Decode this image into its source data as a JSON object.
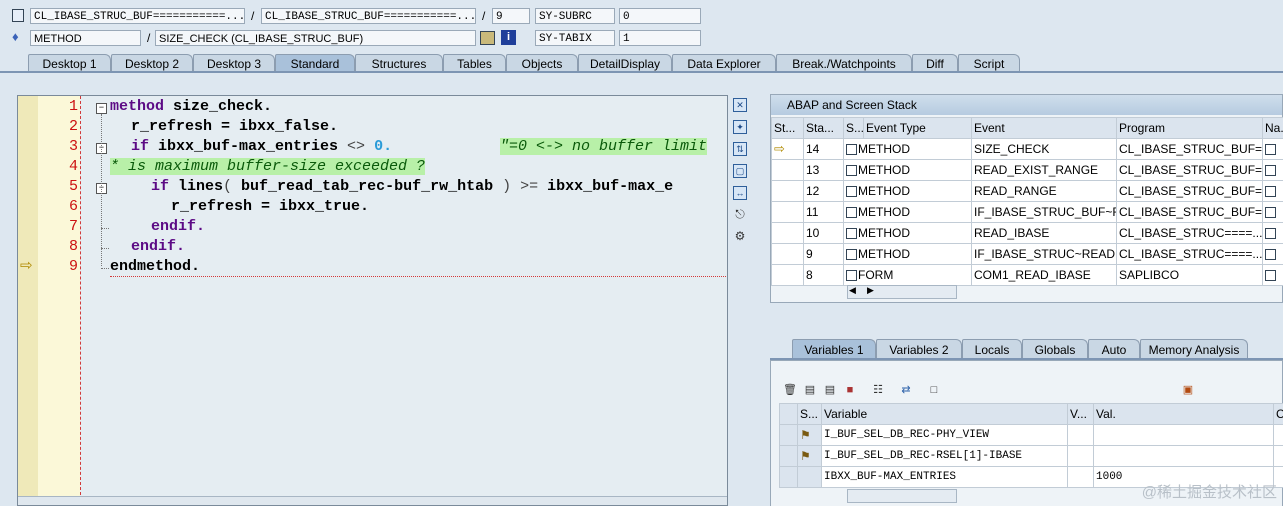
{
  "header": {
    "row1": {
      "program": "CL_IBASE_STRUC_BUF===========...",
      "include": "CL_IBASE_STRUC_BUF===========...",
      "line": "9",
      "sysvar_name": "SY-SUBRC",
      "sysvar_value": "0"
    },
    "row2": {
      "event_type": "METHOD",
      "event": "SIZE_CHECK (CL_IBASE_STRUC_BUF)",
      "sysvar_name": "SY-TABIX",
      "sysvar_value": "1"
    },
    "slash": "/"
  },
  "tabs": [
    "Desktop 1",
    "Desktop 2",
    "Desktop 3",
    "Standard",
    "Structures",
    "Tables",
    "Objects",
    "DetailDisplay",
    "Data Explorer",
    "Break./Watchpoints",
    "Diff",
    "Script"
  ],
  "active_tab": "Standard",
  "editor": {
    "lines": [
      {
        "no": "1"
      },
      {
        "no": "2"
      },
      {
        "no": "3"
      },
      {
        "no": "4"
      },
      {
        "no": "5"
      },
      {
        "no": "6"
      },
      {
        "no": "7"
      },
      {
        "no": "8"
      },
      {
        "no": "9"
      }
    ],
    "code": {
      "l1_kw": "method",
      "l1_rest": " size_check.",
      "l2": "r_refresh = ibxx_false.",
      "l3_kw": "if",
      "l3_rest": " ibxx_buf-max_entries",
      "l3_op": " <> ",
      "l3_num": "0",
      "l3_dot": ".",
      "l3_comment": "\"=0 <-> no buffer limit",
      "l4_comment": "* is maximum buffer-size exceeded ?",
      "l5_kw": "if",
      "l5_rest": " lines",
      "l5_op1": "( ",
      "l5_mid": "buf_read_tab_rec-buf_rw_htab",
      "l5_op2": " ) >= ",
      "l5_tail": "ibxx_buf-max_e",
      "l6": "r_refresh = ibxx_true.",
      "l7": "endif.",
      "l8": "endif.",
      "l9": "endmethod."
    }
  },
  "stack": {
    "title": "ABAP and Screen Stack",
    "columns": [
      "St...",
      "Sta...",
      "S...",
      "Event Type",
      "Event",
      "Program",
      "Na..."
    ],
    "rows": [
      {
        "level": "14",
        "type": "METHOD",
        "event": "SIZE_CHECK",
        "program": "CL_IBASE_STRUC_BUF=..."
      },
      {
        "level": "13",
        "type": "METHOD",
        "event": "READ_EXIST_RANGE",
        "program": "CL_IBASE_STRUC_BUF=..."
      },
      {
        "level": "12",
        "type": "METHOD",
        "event": "READ_RANGE",
        "program": "CL_IBASE_STRUC_BUF=..."
      },
      {
        "level": "11",
        "type": "METHOD",
        "event": "IF_IBASE_STRUC_BUF~R...",
        "program": "CL_IBASE_STRUC_BUF=..."
      },
      {
        "level": "10",
        "type": "METHOD",
        "event": "READ_IBASE",
        "program": "CL_IBASE_STRUC====..."
      },
      {
        "level": "9",
        "type": "METHOD",
        "event": "IF_IBASE_STRUC~READ...",
        "program": "CL_IBASE_STRUC====..."
      },
      {
        "level": "8",
        "type": "FORM",
        "event": "COM1_READ_IBASE",
        "program": "SAPLIBCO"
      }
    ]
  },
  "vartabs": [
    "Variables 1",
    "Variables 2",
    "Locals",
    "Globals",
    "Auto",
    "Memory Analysis"
  ],
  "vars": {
    "columns": [
      "S...",
      "Variable",
      "V...",
      "Val.",
      "C"
    ],
    "rows": [
      {
        "name": "I_BUF_SEL_DB_REC-PHY_VIEW",
        "value": ""
      },
      {
        "name": "I_BUF_SEL_DB_REC-RSEL[1]-IBASE",
        "value": ""
      },
      {
        "name": "IBXX_BUF-MAX_ENTRIES",
        "value": "1000"
      }
    ]
  },
  "watermark": "@稀土掘金技术社区",
  "colors": {
    "accent": "#a9c1da",
    "line_number": "#cc1111",
    "keyword": "#5c0a85",
    "comment_bg": "#b8f0a8"
  }
}
